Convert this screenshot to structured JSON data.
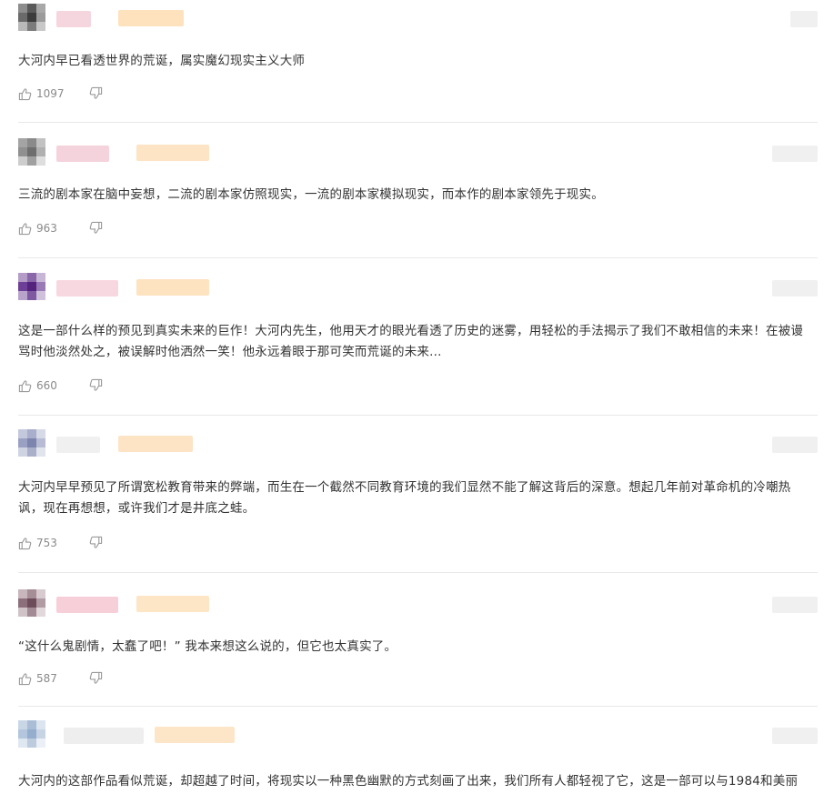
{
  "comments": [
    {
      "text": "大河内早已看透世界的荒诞，属实魔幻现实主义大师",
      "likes": "1097"
    },
    {
      "text": "三流的剧本家在脑中妄想，二流的剧本家仿照现实，一流的剧本家模拟现实，而本作的剧本家领先于现实。",
      "likes": "963"
    },
    {
      "text": "这是一部什么样的预见到真实未来的巨作！大河内先生，他用天才的眼光看透了历史的迷雾，用轻松的手法揭示了我们不敢相信的未来！在被谩骂时他淡然处之，被误解时他洒然一笑！他永远着眼于那可笑而荒诞的未来...",
      "likes": "660"
    },
    {
      "text": "大河内早早预见了所谓宽松教育带来的弊端，而生在一个截然不同教育环境的我们显然不能了解这背后的深意。想起几年前对革命机的冷嘲热讽，现在再想想，或许我们才是井底之蛙。",
      "likes": "753"
    },
    {
      "text": "“这什么鬼剧情，太蠢了吧！” 我本来想这么说的，但它也太真实了。",
      "likes": "587"
    },
    {
      "text": "大河内的这部作品看似荒诞，却超越了时间，将现实以一种黑色幽默的方式刻画了出来，我们所有人都轻视了它，这是一部可以与1984和美丽",
      "likes": ""
    }
  ],
  "colors": {
    "text": "#333333",
    "count": "#8a8a8a",
    "icon": "#9a9a9a",
    "divider": "#e8e8e8"
  },
  "icons": {
    "like": "thumbs-up-icon",
    "dislike": "thumbs-down-icon"
  }
}
